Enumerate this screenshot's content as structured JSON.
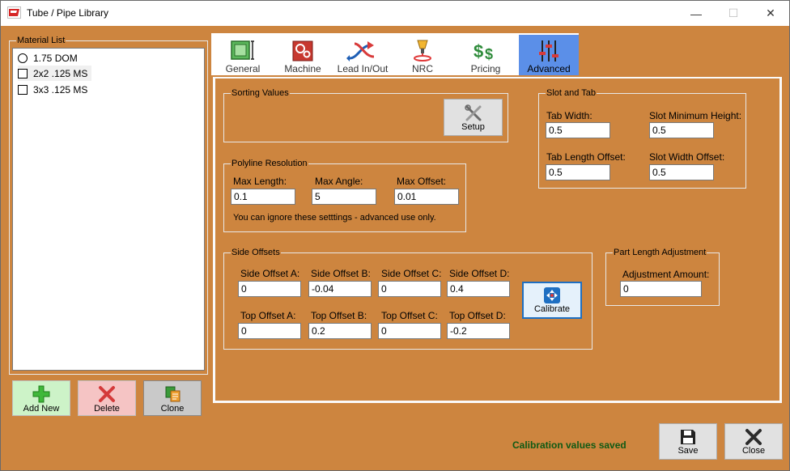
{
  "window": {
    "title": "Tube / Pipe Library",
    "minimize": "—",
    "maximize": "☐",
    "close": "✕"
  },
  "material_list": {
    "title": "Material List",
    "items": [
      {
        "label": "1.75 DOM",
        "marker": "round"
      },
      {
        "label": "2x2 .125 MS",
        "marker": "square"
      },
      {
        "label": "3x3 .125 MS",
        "marker": "square"
      }
    ],
    "add_new": "Add New",
    "delete": "Delete",
    "clone": "Clone"
  },
  "tabs": [
    "General",
    "Machine",
    "Lead In/Out",
    "NRC",
    "Pricing",
    "Advanced"
  ],
  "active_tab": "Advanced",
  "sorting": {
    "title": "Sorting Values",
    "setup_label": "Setup"
  },
  "polyline": {
    "title": "Polyline Resolution",
    "max_length_label": "Max Length:",
    "max_length": "0.1",
    "max_angle_label": "Max Angle:",
    "max_angle": "5",
    "max_offset_label": "Max Offset:",
    "max_offset": "0.01",
    "note": "You can ignore these setttings - advanced use only."
  },
  "slot_tab": {
    "title": "Slot and Tab",
    "tab_width_label": "Tab Width:",
    "tab_width": "0.5",
    "slot_min_height_label": "Slot Minimum Height:",
    "slot_min_height": "0.5",
    "tab_length_offset_label": "Tab Length Offset:",
    "tab_length_offset": "0.5",
    "slot_width_offset_label": "Slot Width Offset:",
    "slot_width_offset": "0.5"
  },
  "side_offsets": {
    "title": "Side Offsets",
    "side_a_label": "Side Offset A:",
    "side_a": "0",
    "side_b_label": "Side Offset B:",
    "side_b": "-0.04",
    "side_c_label": "Side Offset C:",
    "side_c": "0",
    "side_d_label": "Side Offset D:",
    "side_d": "0.4",
    "top_a_label": "Top Offset A:",
    "top_a": "0",
    "top_b_label": "Top Offset B:",
    "top_b": "0.2",
    "top_c_label": "Top Offset C:",
    "top_c": "0",
    "top_d_label": "Top Offset D:",
    "top_d": "-0.2",
    "calibrate_label": "Calibrate"
  },
  "part_length": {
    "title": "Part Length Adjustment",
    "amount_label": "Adjustment Amount:",
    "amount": "0"
  },
  "status_text": "Calibration values saved",
  "save_label": "Save",
  "close_label": "Close",
  "colors": {
    "background": "#cd853f",
    "active_tab": "#5b8fe8",
    "status": "#0e5a14",
    "add_new_bg": "#cdf3c8",
    "delete_bg": "#f5c4c4",
    "clone_bg": "#c9c9c9"
  }
}
